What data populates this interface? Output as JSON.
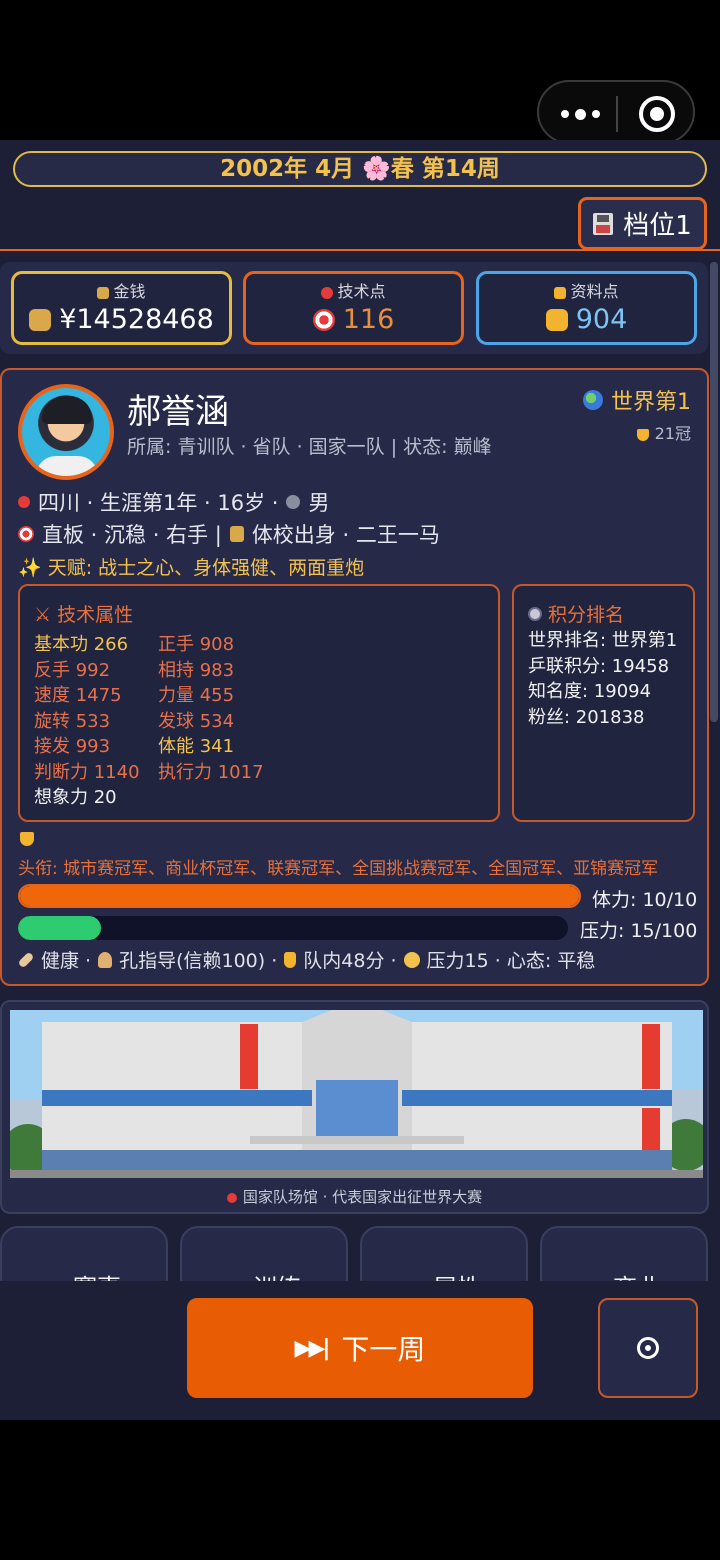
{
  "date_label": "2002年 4月 🌸春 第14周",
  "save_slot": "档位1",
  "stats": {
    "money": {
      "label": "金钱",
      "value": "¥14528468"
    },
    "skill_points": {
      "label": "技术点",
      "value": "116"
    },
    "data_points": {
      "label": "资料点",
      "value": "904"
    }
  },
  "player": {
    "name": "郝誉涵",
    "meta": "所属: 青训队 · 省队 · 国家一队 | 状态: 巅峰",
    "world_rank": "世界第1",
    "titles": "21冠",
    "info_line1": [
      "四川 · 生涯第1年 · 16岁 ·",
      "男"
    ],
    "info_line2": [
      "直板 · 沉稳 · 右手 |",
      "体校出身 · 二王一马"
    ],
    "talent": "✨ 天赋:  战士之心、身体强健、两面重炮"
  },
  "attributes": {
    "title": "⚔ 技术属性",
    "col1": [
      {
        "text": "基本功 266",
        "color": "yellow"
      },
      {
        "text": "反手 992",
        "color": "red"
      },
      {
        "text": "速度 1475",
        "color": "red"
      },
      {
        "text": "旋转 533",
        "color": "red"
      },
      {
        "text": "接发 993",
        "color": "red"
      },
      {
        "text": "判断力 1140",
        "color": "red"
      },
      {
        "text": "想象力 20",
        "color": "white"
      }
    ],
    "col2": [
      {
        "text": "正手 908",
        "color": "red"
      },
      {
        "text": "相持 983",
        "color": "red"
      },
      {
        "text": "力量 455",
        "color": "red"
      },
      {
        "text": "发球 534",
        "color": "red"
      },
      {
        "text": "体能 341",
        "color": "yellow"
      },
      {
        "text": "执行力 1017",
        "color": "red"
      }
    ]
  },
  "ranking": {
    "title": "积分排名",
    "lines": [
      "世界排名: 世界第1",
      "乒联积分: 19458",
      "知名度: 19094",
      "粉丝: 201838"
    ]
  },
  "honors": "头衔:  城市赛冠军、商业杯冠军、联赛冠军、全国挑战赛冠军、全国冠军、亚锦赛冠军",
  "stamina": {
    "label": "体力: 10/10",
    "fraction": 1.0
  },
  "pressure": {
    "label": "压力: 15/100",
    "fraction": 0.15
  },
  "status_items": [
    "健康 ·",
    "孔指导(信赖100) ·",
    "队内48分 ·",
    "压力15 · 心态: 平稳"
  ],
  "venue_caption": "国家队场馆 · 代表国家出征世界大赛",
  "tabs": [
    "赛事",
    "训练",
    "属性",
    "商业"
  ],
  "next_week": "下一周",
  "colors": {
    "accent": "#e85d04",
    "gold": "#f2c14e",
    "panel": "#262a48",
    "bg": "#1c1f35"
  }
}
